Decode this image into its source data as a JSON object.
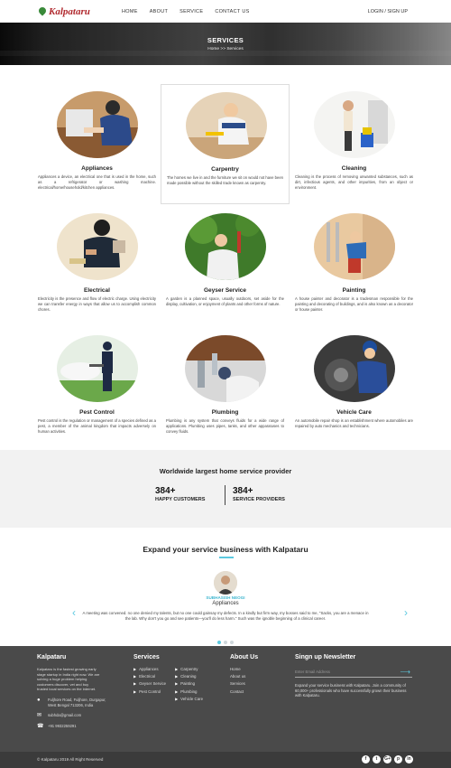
{
  "header": {
    "brand": "Kalpataru",
    "nav": [
      "HOME",
      "ABOUT",
      "SERVICE",
      "CONTACT US"
    ],
    "login": "LOGIN / SIGN UP"
  },
  "banner": {
    "title": "SERVICES",
    "breadcrumb": "Home  >>  Services"
  },
  "services": [
    {
      "title": "Appliances",
      "icon": "appliance-repair-photo",
      "desc": "Appliances a device, an electrical one that is used in the home, such as a refrigerator or washing machine. electrical/home/household/kitchen appliances."
    },
    {
      "title": "Carpentry",
      "icon": "carpenter-photo",
      "desc": "The homes we live in and the furniture we sit on would not have been made possible without the skilled trade known as carpentry."
    },
    {
      "title": "Cleaning",
      "icon": "cleaning-photo",
      "desc": "Cleaning is the process of removing unwanted substances, such as dirt, infectious agents, and other impurities, from an object or environment."
    },
    {
      "title": "Electrical",
      "icon": "electrician-photo",
      "desc": "Electricity is the presence and flow of electric charge. Using electricity we can transfer energy in ways that allow us to accomplish common chores."
    },
    {
      "title": "Geyser Service",
      "icon": "gardener-photo",
      "desc": "A garden is a planned space, usually outdoors, set aside for the display, cultivation, or enjoyment of plants and other forms of nature."
    },
    {
      "title": "Painting",
      "icon": "painter-photo",
      "desc": "A house painter and decorator is a tradesman responsible for the painting and decorating of buildings, and is also known as a decorator or house painter."
    },
    {
      "title": "Pest Control",
      "icon": "pest-control-photo",
      "desc": "Pest control is the regulation or management of a species defined as a pest, a member of the animal kingdom that impacts adversely on human activities."
    },
    {
      "title": "Plumbing",
      "icon": "plumber-photo",
      "desc": "Plumbing is any system that conveys fluids for a wide range of applications. Plumbing uses pipes, tanks, and other apparatuses to convey fluids."
    },
    {
      "title": "Vehicle Care",
      "icon": "mechanic-photo",
      "desc": "An automobile repair shop is an establishment where automobiles are repaired by auto mechanics and technicians."
    }
  ],
  "stats": {
    "heading": "Worldwide largest home service provider",
    "customers_num": "384+",
    "customers_label": "HAPPY CUSTOMERS",
    "providers_num": "384+",
    "providers_label": "SERVICE PROVIDERS"
  },
  "testimonial": {
    "heading": "Expand your service business with Kalpataru",
    "name": "SUBHASISH NEOGI",
    "role": "Appliances",
    "text": "A meeting was convened. no one denied my talents, but no one could gainsay my defects. In a kindly but firm way, my bosses said to me, \"Sacks, you are a menace in the lab. Why don't you go and see patients—you'll do less harm.\" Such was the ignoble beginning of a clinical career.",
    "prev": "‹",
    "next": "›"
  },
  "footer": {
    "brand_title": "Kalpataru",
    "about": "Kalpataru is the fastest growing early stage startup in India right now. We are solving a huge problem helping customers discover, vet and buy trusted local services on the internet.",
    "address": "Fuljhore Road, Fuljhore, Durgapur, West Bengal 713206, India",
    "email": "subhda@gmail.com",
    "phone": "+91 9932259291",
    "services_title": "Services",
    "services_col1": [
      "Appliances",
      "Electrical",
      "Geyser Service",
      "Pest Control"
    ],
    "services_col2": [
      "Carpentry",
      "Cleaning",
      "Painting",
      "Plumbing",
      "Vehicle Care"
    ],
    "about_title": "About Us",
    "about_links": [
      "Home",
      "About us",
      "Services",
      "Contact"
    ],
    "newsletter_title": "Singn up Newsletter",
    "email_placeholder": "Enter Email Address",
    "newsletter_text": "Expand your service business with Kalpataru. Join a community of 60,000+ professionals who have successfully grown their business with Kalpataru.",
    "copyright": "© Kalpataru 2019 All Right Reserved",
    "socials": [
      "f",
      "t",
      "G+",
      "p",
      "in"
    ]
  },
  "colors": {
    "accent": "#5cc9e0",
    "brand_red": "#b0282d",
    "footer_bg": "#4a4a4a"
  }
}
